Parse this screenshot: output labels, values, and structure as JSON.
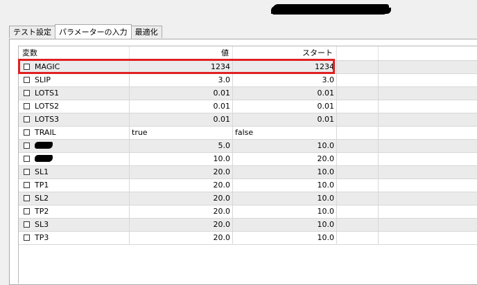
{
  "tabs": [
    {
      "label": "テスト設定"
    },
    {
      "label": "パラメーターの入力"
    },
    {
      "label": "最適化"
    }
  ],
  "columns": [
    "変数",
    "値",
    "スタート"
  ],
  "rows": [
    {
      "name": "MAGIC",
      "value": "1234",
      "start": "1234"
    },
    {
      "name": "SLIP",
      "value": "3.0",
      "start": "3.0"
    },
    {
      "name": "LOTS1",
      "value": "0.01",
      "start": "0.01"
    },
    {
      "name": "LOTS2",
      "value": "0.01",
      "start": "0.01"
    },
    {
      "name": "LOTS3",
      "value": "0.01",
      "start": "0.01"
    },
    {
      "name": "TRAIL",
      "value": "true",
      "start": "false"
    },
    {
      "name": "",
      "value": "5.0",
      "start": "10.0"
    },
    {
      "name": "",
      "value": "10.0",
      "start": "20.0"
    },
    {
      "name": "SL1",
      "value": "20.0",
      "start": "10.0"
    },
    {
      "name": "TP1",
      "value": "20.0",
      "start": "10.0"
    },
    {
      "name": "SL2",
      "value": "20.0",
      "start": "10.0"
    },
    {
      "name": "TP2",
      "value": "20.0",
      "start": "10.0"
    },
    {
      "name": "SL3",
      "value": "20.0",
      "start": "10.0"
    },
    {
      "name": "TP3",
      "value": "20.0",
      "start": "10.0"
    }
  ],
  "highlight_color": "#e02020"
}
